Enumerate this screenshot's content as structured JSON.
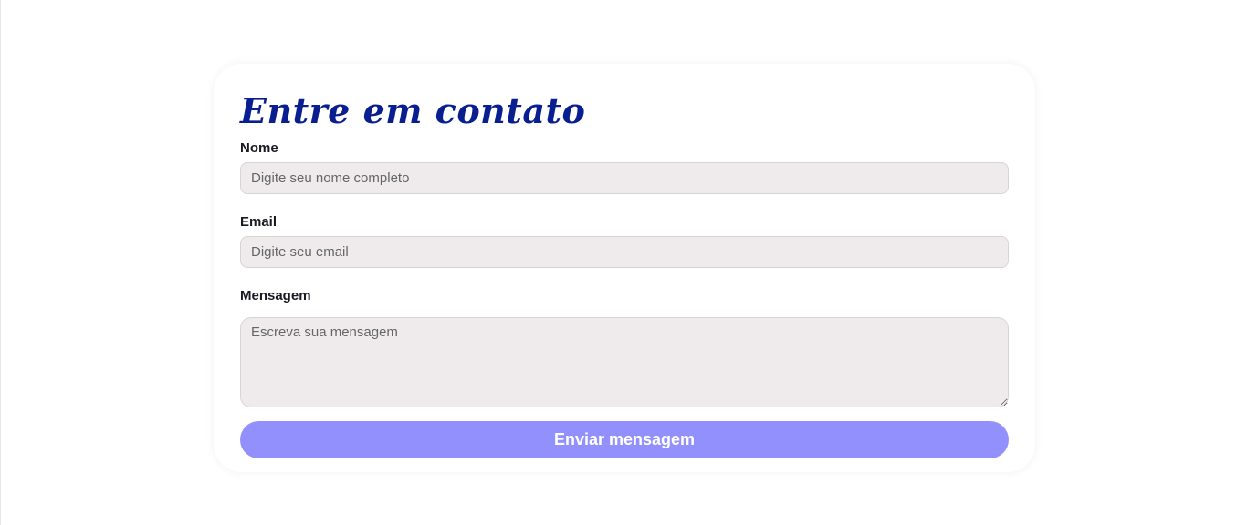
{
  "form": {
    "title": "Entre em contato",
    "name": {
      "label": "Nome",
      "placeholder": "Digite seu nome completo",
      "value": ""
    },
    "email": {
      "label": "Email",
      "placeholder": "Digite seu email",
      "value": ""
    },
    "message": {
      "label": "Mensagem",
      "placeholder": "Escreva sua mensagem",
      "value": ""
    },
    "submit_label": "Enviar mensagem"
  },
  "colors": {
    "title": "#0a1f8f",
    "button_bg": "#9290fd",
    "input_bg": "#efebec"
  }
}
